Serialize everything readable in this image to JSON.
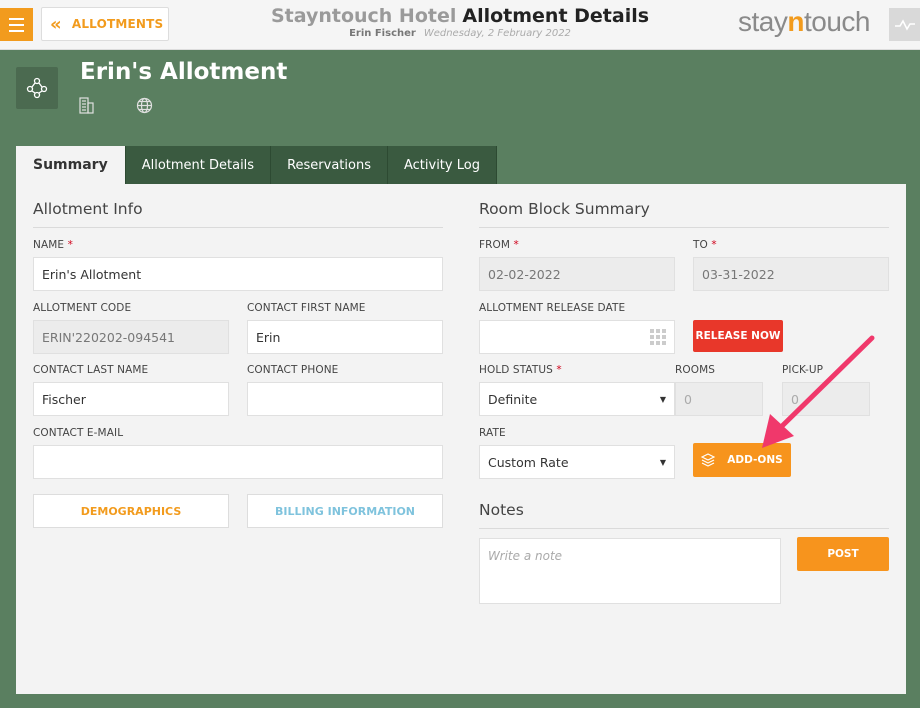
{
  "topbar": {
    "back_label": "ALLOTMENTS",
    "hotel_name": "Stayntouch Hotel",
    "page_name": "Allotment Details",
    "user_name": "Erin Fischer",
    "date": "Wednesday, 2 February 2022",
    "logo": {
      "pre": "stay",
      "mid": "n",
      "post": "touch"
    }
  },
  "header": {
    "title": "Erin's Allotment",
    "icons": [
      "group-icon",
      "building-icon",
      "globe-icon"
    ]
  },
  "tabs": [
    {
      "label": "Summary"
    },
    {
      "label": "Allotment Details"
    },
    {
      "label": "Reservations"
    },
    {
      "label": "Activity Log"
    }
  ],
  "allotment_info": {
    "title": "Allotment Info",
    "name": {
      "label": "NAME",
      "value": "Erin's Allotment"
    },
    "code": {
      "label": "ALLOTMENT CODE",
      "value": "ERIN'220202-094541"
    },
    "first_name": {
      "label": "CONTACT FIRST NAME",
      "value": "Erin"
    },
    "last_name": {
      "label": "CONTACT LAST NAME",
      "value": "Fischer"
    },
    "phone": {
      "label": "CONTACT PHONE",
      "value": ""
    },
    "email": {
      "label": "CONTACT E-MAIL",
      "value": ""
    },
    "demographics_label": "DEMOGRAPHICS",
    "billing_label": "BILLING INFORMATION"
  },
  "room_block": {
    "title": "Room Block Summary",
    "from": {
      "label": "FROM",
      "value": "02-02-2022"
    },
    "to": {
      "label": "TO",
      "value": "03-31-2022"
    },
    "release": {
      "label": "ALLOTMENT RELEASE DATE",
      "value": ""
    },
    "release_now_label": "RELEASE NOW",
    "hold_status": {
      "label": "HOLD STATUS",
      "value": "Definite"
    },
    "rooms": {
      "label": "ROOMS",
      "value": "0"
    },
    "pickup": {
      "label": "PICK-UP",
      "value": "0"
    },
    "rate": {
      "label": "RATE",
      "value": "Custom Rate"
    },
    "addons_label": "ADD-ONS"
  },
  "notes": {
    "title": "Notes",
    "placeholder": "Write a note",
    "post_label": "POST"
  },
  "colors": {
    "accent": "#f29b1d",
    "background": "#5a7f60",
    "tab_dark": "#3a5a40",
    "danger": "#e8372a",
    "link_blue": "#7fc3dd",
    "annotation_arrow": "#f0386b"
  }
}
